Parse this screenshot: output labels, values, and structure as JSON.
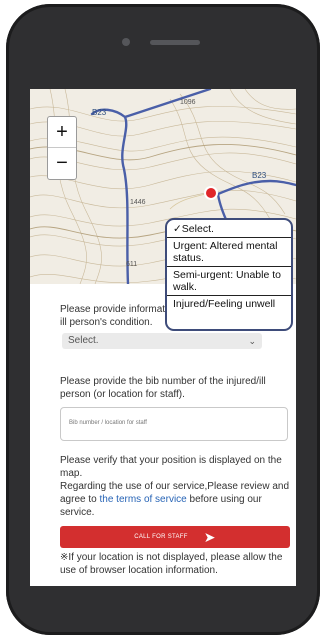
{
  "map": {
    "zoom_in": "+",
    "zoom_out": "−",
    "road_labels": [
      "B23",
      "B23"
    ],
    "elevation_labels": [
      "1096",
      "1446",
      "611"
    ]
  },
  "form": {
    "condition_label": "Please provide information on the injured or ill person's condition.",
    "condition_select_value": "Select.",
    "condition_options": [
      "✓Select.",
      "Urgent: Altered mental status.",
      "Semi-urgent: Unable to walk.",
      "Injured/Feeling unwell"
    ],
    "bib_label": "Please provide the bib number of the injured/ill person (or location for staff).",
    "bib_placeholder": "Bib number / location for staff",
    "verify_text": "Please verify that your position is displayed on the map.",
    "service_text_1": "Regarding the use of our service,Please review and agree to ",
    "tos_link": "the terms of service",
    "service_text_2": " before using our service.",
    "call_button": "CALL FOR STAFF",
    "location_text": "※If your location is not displayed, please allow the use of browser location information."
  },
  "colors": {
    "frame": "#2f2f31",
    "button": "#d32f2f",
    "link": "#2764b6",
    "road": "#4a5fa8",
    "marker": "#e0262a"
  }
}
